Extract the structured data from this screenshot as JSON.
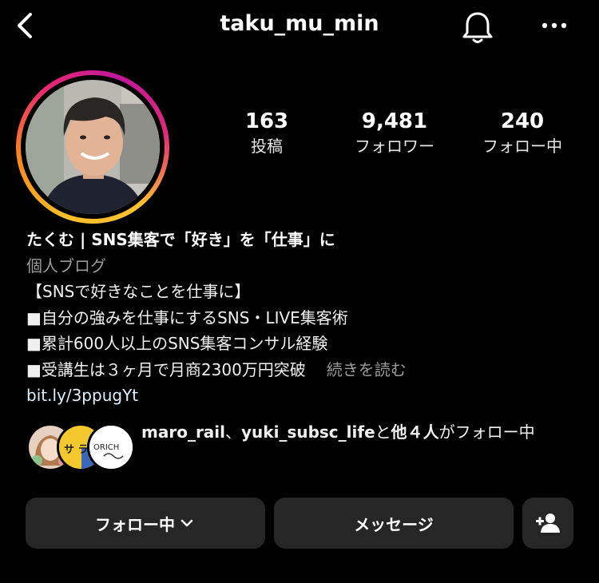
{
  "header": {
    "username": "taku_mu_min",
    "back_icon": "chevron-left-icon",
    "bell_icon": "bell-icon",
    "more_icon": "more-horizontal-icon"
  },
  "stats": [
    {
      "value": "163",
      "label": "投稿"
    },
    {
      "value": "9,481",
      "label": "フォロワー"
    },
    {
      "value": "240",
      "label": "フォロー中"
    }
  ],
  "bio": {
    "name": "たくむ | SNS集客で「好き」を「仕事」に",
    "category": "個人ブログ",
    "lines": [
      "【SNSで好きなことを仕事に】",
      "■自分の強みを仕事にするSNS・LIVE集客術",
      "■累計600人以上のSNS集客コンサル経験",
      "■受講生は３ヶ月で月商2300万円突破"
    ],
    "more": "続きを読む",
    "link": "bit.ly/3ppugYt"
  },
  "followed_by": {
    "user1": "maro_rail",
    "sep": "、",
    "user2": "yuki_subsc_life",
    "mid": "と",
    "others": "他４人",
    "suffix": "がフォロー中"
  },
  "avatar_texts": {
    "second": "サ ラ ジ オ",
    "third": "ORICH"
  },
  "buttons": {
    "following": "フォロー中",
    "message": "メッセージ",
    "add_user_icon": "add-user-icon"
  },
  "colors": {
    "background": "#000000",
    "button_bg": "#262626",
    "secondary_text": "#9a9a9a",
    "link": "#e0f1ff"
  }
}
